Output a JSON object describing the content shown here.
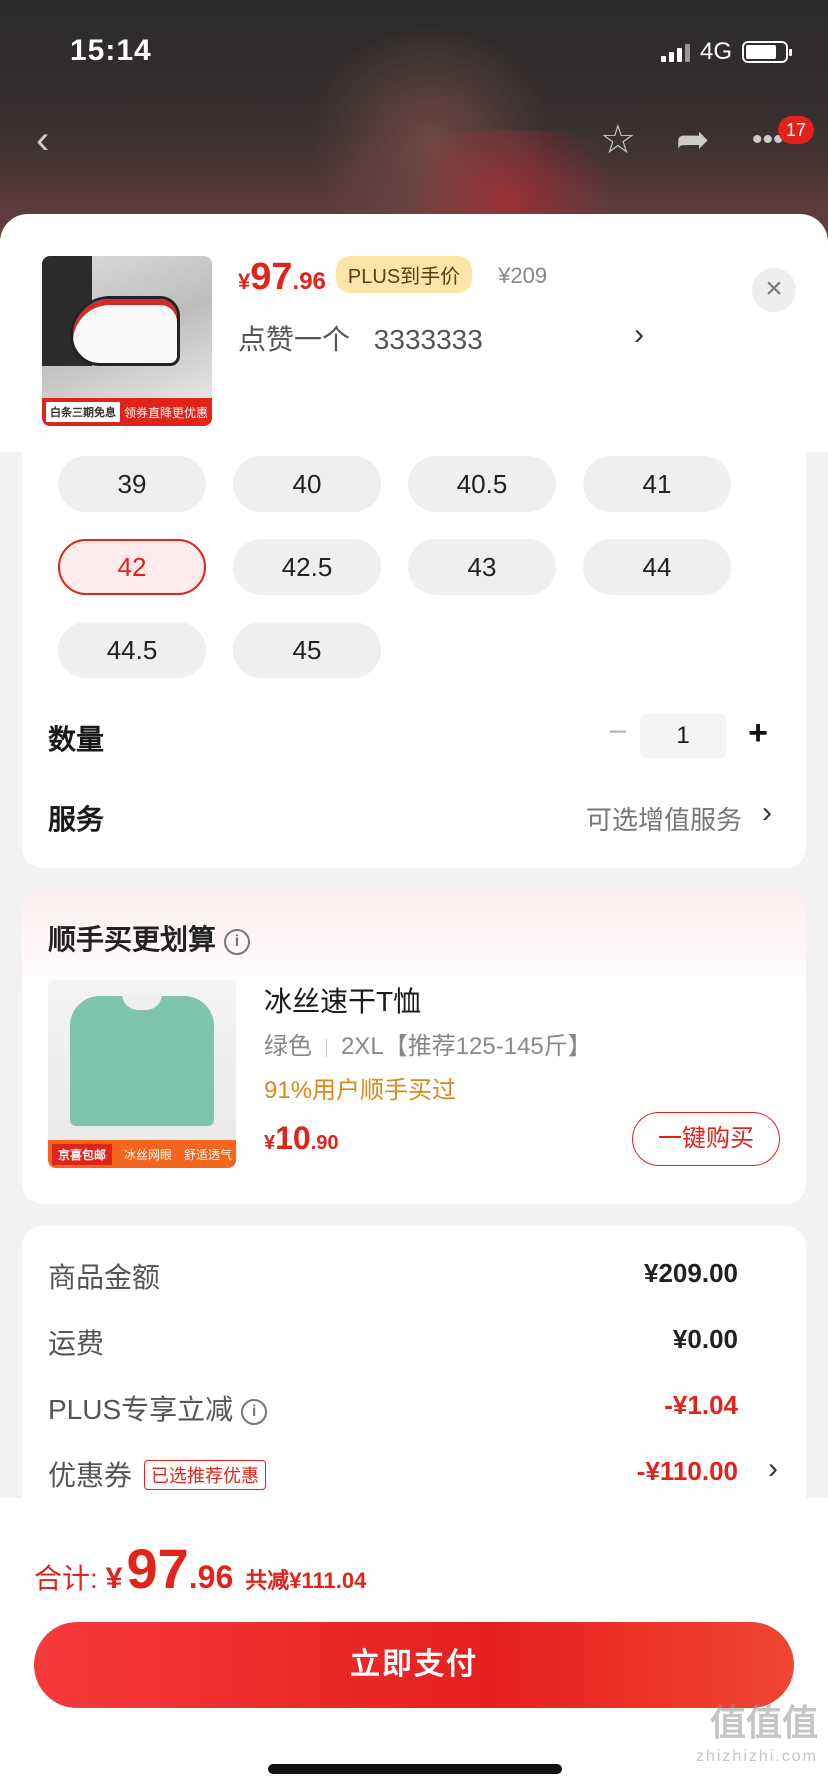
{
  "status_bar": {
    "time": "15:14",
    "network": "4G"
  },
  "nav": {
    "badge_count": "17"
  },
  "product": {
    "thumb_tag_left": "白条三期免息",
    "thumb_tag_right": "领券直降更优惠",
    "price_currency": "¥",
    "price_int": "97",
    "price_dec": ".96",
    "plus_label": "PLUS到手价",
    "original_price": "¥209",
    "variant_label": "点赞一个",
    "variant_value": "3333333"
  },
  "sizes": {
    "options": [
      "39",
      "40",
      "40.5",
      "41",
      "42",
      "42.5",
      "43",
      "44",
      "44.5",
      "45"
    ],
    "selected": "42"
  },
  "quantity": {
    "label": "数量",
    "value": "1"
  },
  "service": {
    "label": "服务",
    "value": "可选增值服务"
  },
  "recommend": {
    "title": "顺手买更划算",
    "name": "冰丝速干T恤",
    "color": "绿色",
    "size": "2XL【推荐125-145斤】",
    "sales_text": "91%用户顺手买过",
    "price_currency": "¥",
    "price_int": "10",
    "price_dec": ".90",
    "buy_label": "一键购买",
    "thumb_band_tag": "京喜包邮",
    "thumb_band_1": "冰丝网眼",
    "thumb_band_2": "舒适透气"
  },
  "summary": {
    "goods_label": "商品金额",
    "goods_value": "¥209.00",
    "shipping_label": "运费",
    "shipping_value": "¥0.00",
    "plus_label": "PLUS专享立减",
    "plus_value": "-¥1.04",
    "coupon_label": "优惠券",
    "coupon_tag": "已选推荐优惠",
    "coupon_value": "-¥110.00"
  },
  "footer": {
    "total_label": "合计:",
    "total_currency": "¥",
    "total_int": "97",
    "total_dec": ".96",
    "total_save": "共减¥111.04",
    "pay_label": "立即支付"
  },
  "watermark": {
    "main": "值值值",
    "sub": "zhizhizhi.com"
  },
  "colors": {
    "accent": "#e2231a",
    "plus_gold": "#fbe5a8",
    "sales_orange": "#d88a1a"
  }
}
